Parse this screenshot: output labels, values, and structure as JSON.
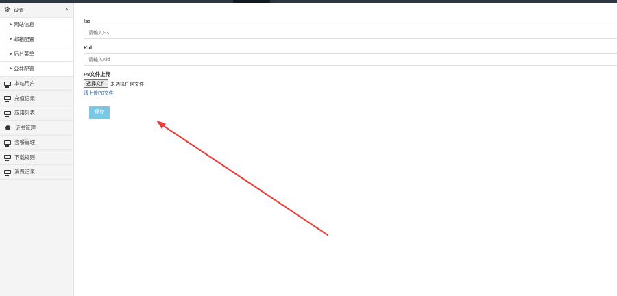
{
  "sidebar": {
    "section": {
      "label": "设置",
      "chevron": "›"
    },
    "subitems": [
      {
        "label": "网站信息"
      },
      {
        "label": "邮箱配置"
      },
      {
        "label": "后台菜单"
      },
      {
        "label": "公共配置"
      }
    ],
    "menu": [
      {
        "label": "本站用户",
        "icon": "monitor-icon"
      },
      {
        "label": "充值记录",
        "icon": "monitor-icon"
      },
      {
        "label": "应用列表",
        "icon": "monitor-icon"
      },
      {
        "label": "证书管理",
        "icon": "dot-icon"
      },
      {
        "label": "套餐管理",
        "icon": "monitor-icon"
      },
      {
        "label": "下载规则",
        "icon": "monitor-icon"
      },
      {
        "label": "消费记录",
        "icon": "monitor-icon"
      }
    ]
  },
  "form": {
    "iss": {
      "label": "Iss",
      "placeholder": "请输入Iss"
    },
    "kid": {
      "label": "Kid",
      "placeholder": "请输入Kid"
    },
    "p8": {
      "label": "P8文件上传",
      "button": "选择文件",
      "status": "未选择任何文件",
      "link": "请上传P8文件"
    },
    "save": "保存"
  },
  "annotation": {
    "color": "#e8403a"
  }
}
